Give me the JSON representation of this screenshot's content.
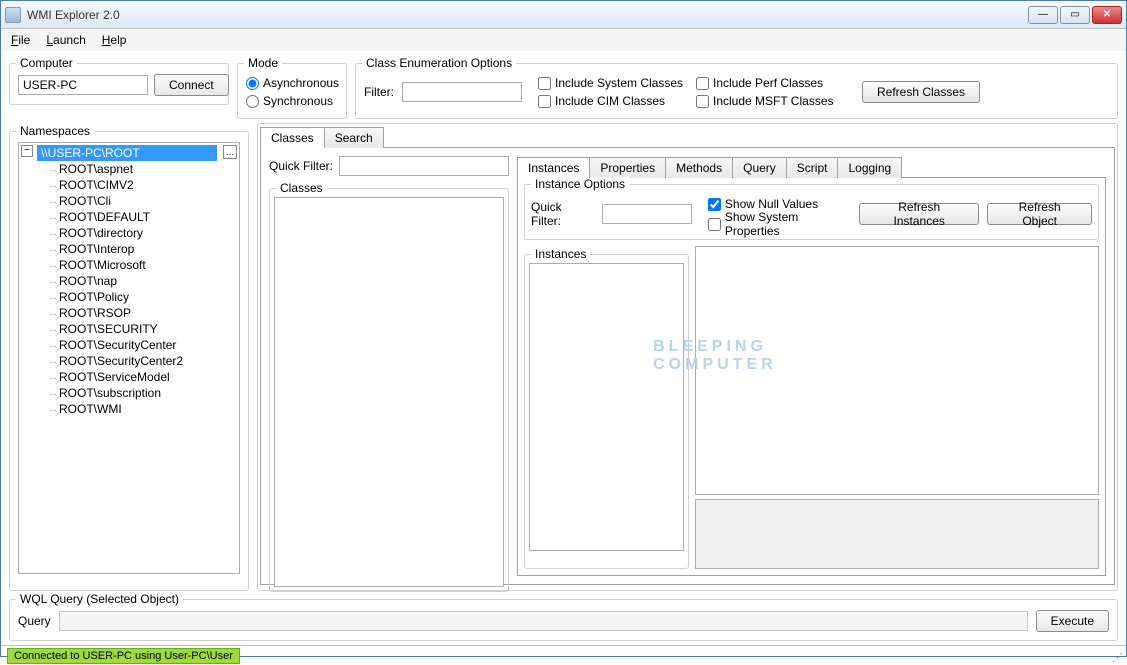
{
  "window": {
    "title": "WMI Explorer 2.0"
  },
  "menu": {
    "file": "File",
    "launch": "Launch",
    "help": "Help"
  },
  "computer": {
    "label": "Computer",
    "value": "USER-PC",
    "connect": "Connect"
  },
  "mode": {
    "label": "Mode",
    "async": "Asynchronous",
    "sync": "Synchronous",
    "selected": "async"
  },
  "enum": {
    "label": "Class Enumeration Options",
    "filter_label": "Filter:",
    "filter_value": "",
    "sys": "Include System Classes",
    "cim": "Include CIM Classes",
    "perf": "Include Perf Classes",
    "msft": "Include MSFT Classes",
    "refresh": "Refresh Classes"
  },
  "namespaces": {
    "label": "Namespaces",
    "root": "\\\\USER-PC\\ROOT",
    "items": [
      "ROOT\\aspnet",
      "ROOT\\CIMV2",
      "ROOT\\Cli",
      "ROOT\\DEFAULT",
      "ROOT\\directory",
      "ROOT\\Interop",
      "ROOT\\Microsoft",
      "ROOT\\nap",
      "ROOT\\Policy",
      "ROOT\\RSOP",
      "ROOT\\SECURITY",
      "ROOT\\SecurityCenter",
      "ROOT\\SecurityCenter2",
      "ROOT\\ServiceModel",
      "ROOT\\subscription",
      "ROOT\\WMI"
    ]
  },
  "classtabs": {
    "classes": "Classes",
    "search": "Search"
  },
  "classes": {
    "quickfilter_label": "Quick Filter:",
    "quickfilter_value": "",
    "panel": "Classes"
  },
  "subtabs": {
    "instances": "Instances",
    "properties": "Properties",
    "methods": "Methods",
    "query": "Query",
    "script": "Script",
    "logging": "Logging"
  },
  "instopts": {
    "label": "Instance Options",
    "quickfilter_label": "Quick Filter:",
    "quickfilter_value": "",
    "shownull": "Show Null Values",
    "showsys": "Show System Properties",
    "refresh_inst": "Refresh Instances",
    "refresh_obj": "Refresh Object"
  },
  "instances": {
    "label": "Instances"
  },
  "wql": {
    "label": "WQL Query (Selected Object)",
    "query_label": "Query",
    "query_value": "",
    "execute": "Execute"
  },
  "status": {
    "text": "Connected to USER-PC using User-PC\\User"
  },
  "watermark": {
    "line1": "BLEEPING",
    "line2": "COMPUTER"
  }
}
